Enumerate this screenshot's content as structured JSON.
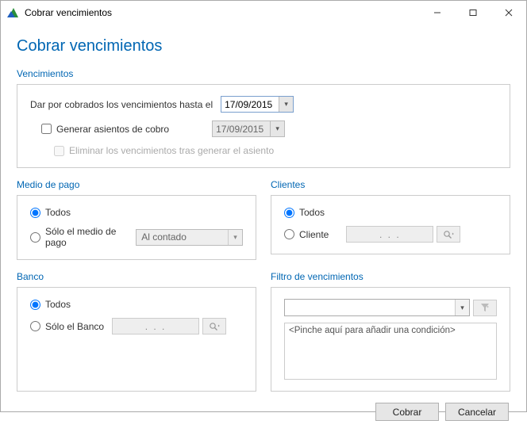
{
  "window": {
    "title": "Cobrar vencimientos"
  },
  "page": {
    "title": "Cobrar vencimientos"
  },
  "venc": {
    "label": "Vencimientos",
    "until_label": "Dar por cobrados los vencimientos hasta el",
    "date1": "17/09/2015",
    "gen_label": "Generar asientos de cobro",
    "date2": "17/09/2015",
    "del_label": "Eliminar los vencimientos tras generar el asiento"
  },
  "medio": {
    "label": "Medio de pago",
    "todos": "Todos",
    "solo": "Sólo el medio de pago",
    "value": "Al contado"
  },
  "clientes": {
    "label": "Clientes",
    "todos": "Todos",
    "cliente": "Cliente",
    "value": ".     .     ."
  },
  "banco": {
    "label": "Banco",
    "todos": "Todos",
    "solo": "Sólo el Banco",
    "value": ".     .     ."
  },
  "filtro": {
    "label": "Filtro de vencimientos",
    "placeholder": "<Pinche aquí para añadir una condición>"
  },
  "buttons": {
    "cobrar": "Cobrar",
    "cancelar": "Cancelar"
  }
}
